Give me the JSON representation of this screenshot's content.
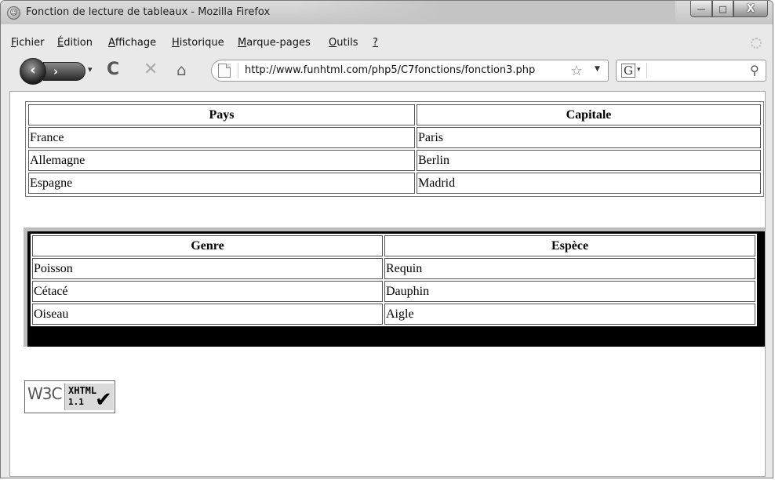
{
  "window": {
    "title": "Fonction de lecture de tableaux - Mozilla Firefox",
    "minimize_glyph": "—",
    "maximize_glyph": "□",
    "close_glyph": "X"
  },
  "menu": [
    {
      "accel": "F",
      "rest": "ichier"
    },
    {
      "accel": "É",
      "rest": "dition"
    },
    {
      "accel": "A",
      "rest": "ffichage"
    },
    {
      "accel": "H",
      "rest": "istorique"
    },
    {
      "accel": "M",
      "rest": "arque-pages"
    },
    {
      "accel": "O",
      "rest": "utils"
    },
    {
      "accel": "?",
      "rest": ""
    }
  ],
  "navigation": {
    "url": "http://www.funhtml.com/php5/C7fonctions/fonction3.php",
    "back_glyph": "‹",
    "forward_glyph": "›",
    "reload_glyph": "C",
    "stop_glyph": "✕",
    "home_glyph": "⌂",
    "star_glyph": "☆",
    "search_engine_glyph": "G",
    "search_value": ""
  },
  "table_countries": {
    "headers": [
      "Pays",
      "Capitale"
    ],
    "rows": [
      [
        "France",
        "Paris"
      ],
      [
        "Allemagne",
        "Berlin"
      ],
      [
        "Espagne",
        "Madrid"
      ]
    ]
  },
  "table_species": {
    "headers": [
      "Genre",
      "Espèce"
    ],
    "rows": [
      [
        "Poisson",
        "Requin"
      ],
      [
        "Cétacé",
        "Dauphin"
      ],
      [
        "Oiseau",
        "Aigle"
      ]
    ]
  },
  "badge": {
    "w3c": "W3C",
    "label": "XHTML",
    "version": "1.1"
  }
}
